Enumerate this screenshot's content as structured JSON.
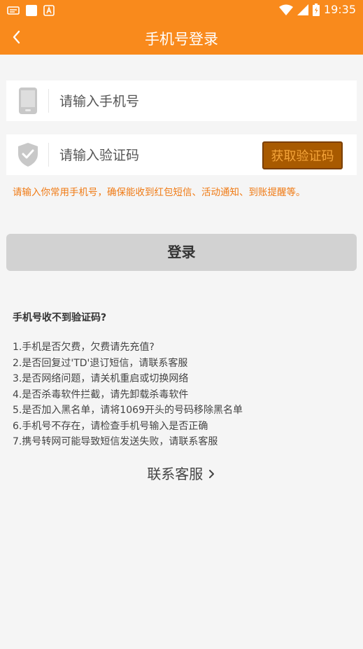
{
  "status_bar": {
    "time": "19:35",
    "icons": [
      "message-icon",
      "notification-square-icon",
      "app-a-icon",
      "wifi-icon",
      "signal-icon",
      "battery-icon"
    ]
  },
  "header": {
    "title": "手机号登录",
    "back_icon": "chevron-left-icon"
  },
  "phone_field": {
    "placeholder": "请输入手机号",
    "icon": "phone-icon"
  },
  "code_field": {
    "placeholder": "请输入验证码",
    "icon": "shield-check-icon",
    "get_code_label": "获取验证码"
  },
  "hint": "请输入你常用手机号，确保能收到红包短信、活动通知、到账提醒等。",
  "login_label": "登录",
  "faq": {
    "title": "手机号收不到验证码?",
    "items": [
      "1.手机是否欠费，欠费请先充值?",
      "2.是否回复过'TD'退订短信，请联系客服",
      "3.是否网络问题，请关机重启或切换网络",
      "4.是否杀毒软件拦截，请先卸载杀毒软件",
      "5.是否加入黑名单，请将1069开头的号码移除黑名单",
      "6.手机号不存在，请检查手机号输入是否正确",
      " 7.携号转网可能导致短信发送失败，请联系客服"
    ]
  },
  "contact_label": "联系客服",
  "colors": {
    "brand": "#f98a1c",
    "hint": "#f07a14",
    "get_code_bg": "#a85a00",
    "get_code_text": "#f4a43a",
    "login_bg": "#d2d2d2"
  }
}
